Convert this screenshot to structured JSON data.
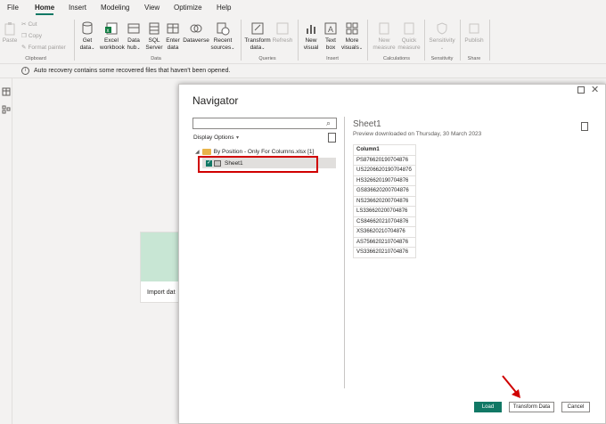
{
  "menu": [
    "File",
    "Home",
    "Insert",
    "Modeling",
    "View",
    "Optimize",
    "Help"
  ],
  "ribbon": {
    "clipboard": {
      "paste": "Paste",
      "cut": "Cut",
      "copy": "Copy",
      "format_painter": "Format painter",
      "group": "Clipboard"
    },
    "data": {
      "get_data": [
        "Get",
        "data"
      ],
      "excel": [
        "Excel",
        "workbook"
      ],
      "data_hub": [
        "Data",
        "hub"
      ],
      "sql": [
        "SQL",
        "Server"
      ],
      "enter": [
        "Enter",
        "data"
      ],
      "dataverse": [
        "Dataverse"
      ],
      "recent": [
        "Recent",
        "sources"
      ],
      "group": "Data"
    },
    "queries": {
      "transform": [
        "Transform",
        "data"
      ],
      "refresh": [
        "Refresh"
      ],
      "group": "Queries"
    },
    "insert": {
      "new_visual": [
        "New",
        "visual"
      ],
      "text_box": [
        "Text",
        "box"
      ],
      "more_visuals": [
        "More",
        "visuals"
      ],
      "group": "Insert"
    },
    "calculations": {
      "new_measure": [
        "New",
        "measure"
      ],
      "quick_measure": [
        "Quick",
        "measure"
      ],
      "group": "Calculations"
    },
    "sensitivity": {
      "label": [
        "Sensitivity"
      ],
      "group": "Sensitivity"
    },
    "share": {
      "publish": [
        "Publish"
      ],
      "group": "Share"
    }
  },
  "infobar": {
    "text": "Auto recovery contains some recovered files that haven't been opened."
  },
  "canvas": {
    "import_label": "Import dat"
  },
  "navigator": {
    "title": "Navigator",
    "display_options": "Display Options",
    "file_node": "By Position - Only For Columns.xlsx [1]",
    "sheet_node": "Sheet1",
    "preview_title": "Sheet1",
    "preview_subtitle": "Preview downloaded on Thursday, 30 March 2023",
    "table_header": "Column1",
    "table_rows": [
      "PS876620190704876",
      "US220662019070487б",
      "HS326620190704876",
      "GS836620200704876",
      "NS236620200704876",
      "LS336620200704876",
      "CS846620210704876",
      "XS36620210704876",
      "AS756620210704876",
      "VS336620210704876"
    ],
    "buttons": {
      "load": "Load",
      "transform": "Transform Data",
      "cancel": "Cancel"
    }
  },
  "colors": {
    "accent": "#117865",
    "highlight": "#d00000"
  }
}
